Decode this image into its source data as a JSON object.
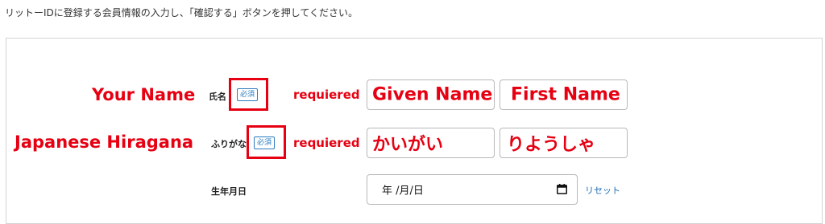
{
  "intro_text": "リットーIDに登録する会員情報の入力し、「確認する」ボタンを押してください。",
  "annotations": {
    "your_name": "Your Name",
    "japanese_hiragana": "Japanese Hiragana",
    "requiered_1": "requiered",
    "requiered_2": "requiered"
  },
  "form": {
    "name_label": "氏名",
    "furigana_label": "ふりがな",
    "required_badge": "必須",
    "given_name_value": "Given Name",
    "first_name_value": "First Name",
    "hiragana_given_value": "かいがい",
    "hiragana_first_value": "りようしゃ",
    "birthdate_label": "生年月日",
    "date_placeholder": "年 /月/日",
    "reset_label": "リセット"
  },
  "colors": {
    "annotation_red": "#e60012",
    "badge_blue": "#2a7bbf",
    "link_blue": "#1e6fb8"
  },
  "icons": {
    "calendar": "calendar-icon"
  }
}
